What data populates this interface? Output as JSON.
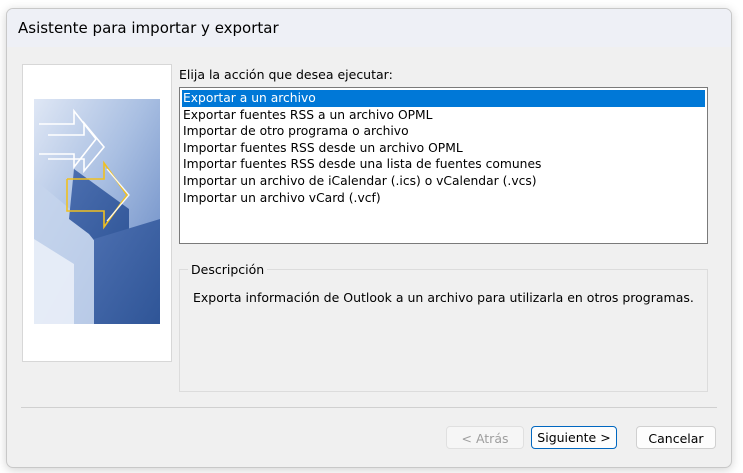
{
  "window": {
    "title": "Asistente para importar y exportar"
  },
  "prompt": "Elija la acción que desea ejecutar:",
  "actions": [
    {
      "label": "Exportar a un archivo",
      "selected": true
    },
    {
      "label": "Exportar fuentes RSS a un archivo OPML",
      "selected": false
    },
    {
      "label": "Importar de otro programa o archivo",
      "selected": false
    },
    {
      "label": "Importar fuentes RSS desde un archivo OPML",
      "selected": false
    },
    {
      "label": "Importar fuentes RSS desde una lista de fuentes comunes",
      "selected": false
    },
    {
      "label": "Importar un archivo de iCalendar (.ics) o vCalendar (.vcs)",
      "selected": false
    },
    {
      "label": "Importar un archivo vCard (.vcf)",
      "selected": false
    }
  ],
  "description": {
    "legend": "Descripción",
    "text": "Exporta información de Outlook a un archivo para utilizarla en otros programas."
  },
  "buttons": {
    "back": "< Atrás",
    "next": "Siguiente >",
    "cancel": "Cancelar"
  },
  "colors": {
    "selection": "#0078d7",
    "art_dark": "#2f5597",
    "art_light": "#a9bfe2",
    "arrow_accent": "#f0c020"
  }
}
